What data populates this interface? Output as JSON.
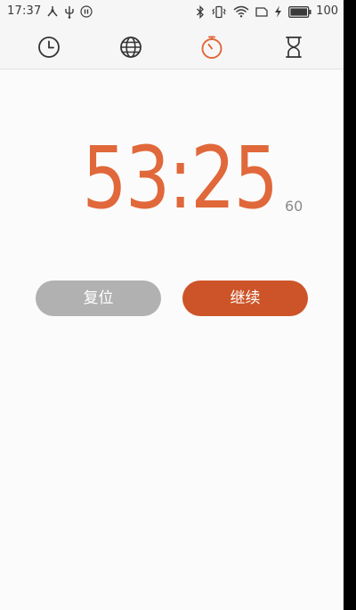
{
  "status_bar": {
    "time": "17:37",
    "battery_level": "100",
    "left_icons": [
      "network-share-icon",
      "usb-icon",
      "paused-icon"
    ],
    "right_icons": [
      "bluetooth-icon",
      "vibrate-icon",
      "wifi-icon",
      "sim-card-icon",
      "charging-icon",
      "battery-icon"
    ]
  },
  "tabs": [
    {
      "icon": "clock-icon",
      "selected": false
    },
    {
      "icon": "globe-icon",
      "selected": false
    },
    {
      "icon": "stopwatch-icon",
      "selected": true
    },
    {
      "icon": "hourglass-icon",
      "selected": false
    }
  ],
  "stopwatch": {
    "main": "53:25",
    "fraction": "60"
  },
  "buttons": {
    "reset_label": "复位",
    "continue_label": "继续"
  },
  "colors": {
    "accent": "#e0683a",
    "continue_button": "#cd5428",
    "reset_button": "#b1b1b1",
    "background": "#fbfbfb"
  }
}
